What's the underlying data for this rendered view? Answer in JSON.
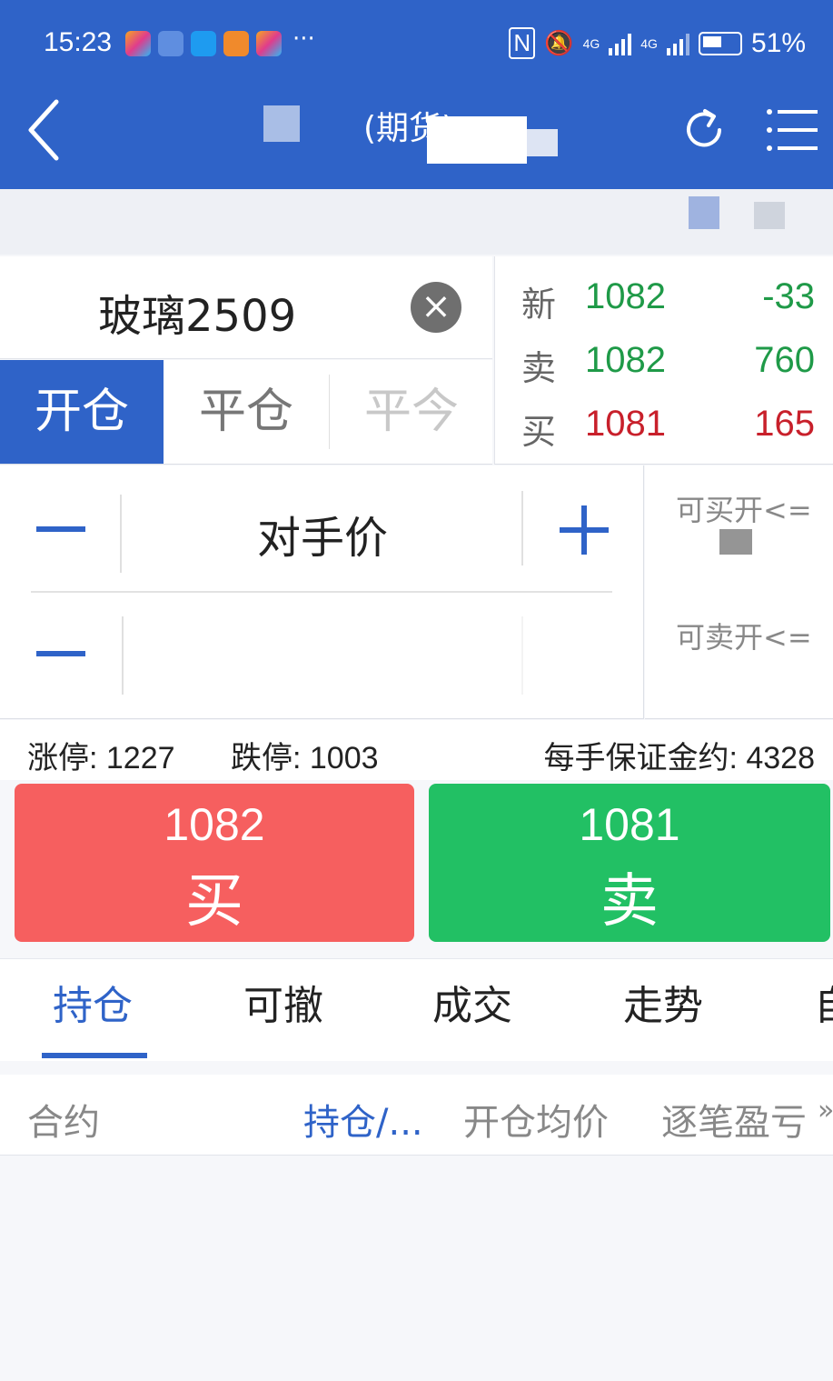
{
  "status_bar": {
    "time": "15:23",
    "more": "···",
    "network1": "4G",
    "network2": "4G",
    "battery": "51%"
  },
  "nav": {
    "title": "(期货)",
    "back_icon": "chevron-left-icon",
    "refresh_icon": "refresh-icon",
    "menu_icon": "list-menu-icon"
  },
  "instrument": {
    "name": "玻璃2509"
  },
  "order_tabs": [
    "开仓",
    "平仓",
    "平今"
  ],
  "quote": {
    "latest": {
      "label": "新",
      "price": "1082",
      "change": "-33"
    },
    "ask": {
      "label": "卖",
      "price": "1082",
      "volume": "760"
    },
    "bid": {
      "label": "买",
      "price": "1081",
      "volume": "165"
    }
  },
  "price_field": {
    "label": "对手价"
  },
  "available": {
    "buy_open": "可买开<=",
    "sell_open": "可卖开<="
  },
  "limits": {
    "up": "涨停: 1227",
    "down": "跌停: 1003",
    "margin": "每手保证金约: 4328"
  },
  "buy_button": {
    "price": "1082",
    "action": "买"
  },
  "sell_button": {
    "price": "1081",
    "action": "卖"
  },
  "bottom_tabs": [
    "持仓",
    "可撤",
    "成交",
    "走势",
    "自"
  ],
  "position_table": {
    "headers": [
      "合约",
      "持仓/...",
      "开仓均价",
      "逐笔盈亏"
    ]
  },
  "colors": {
    "brand": "#2f63c8",
    "buy": "#f65f5f",
    "sell": "#22c064",
    "up_text": "#c8202b",
    "down_text": "#1f9a48"
  }
}
